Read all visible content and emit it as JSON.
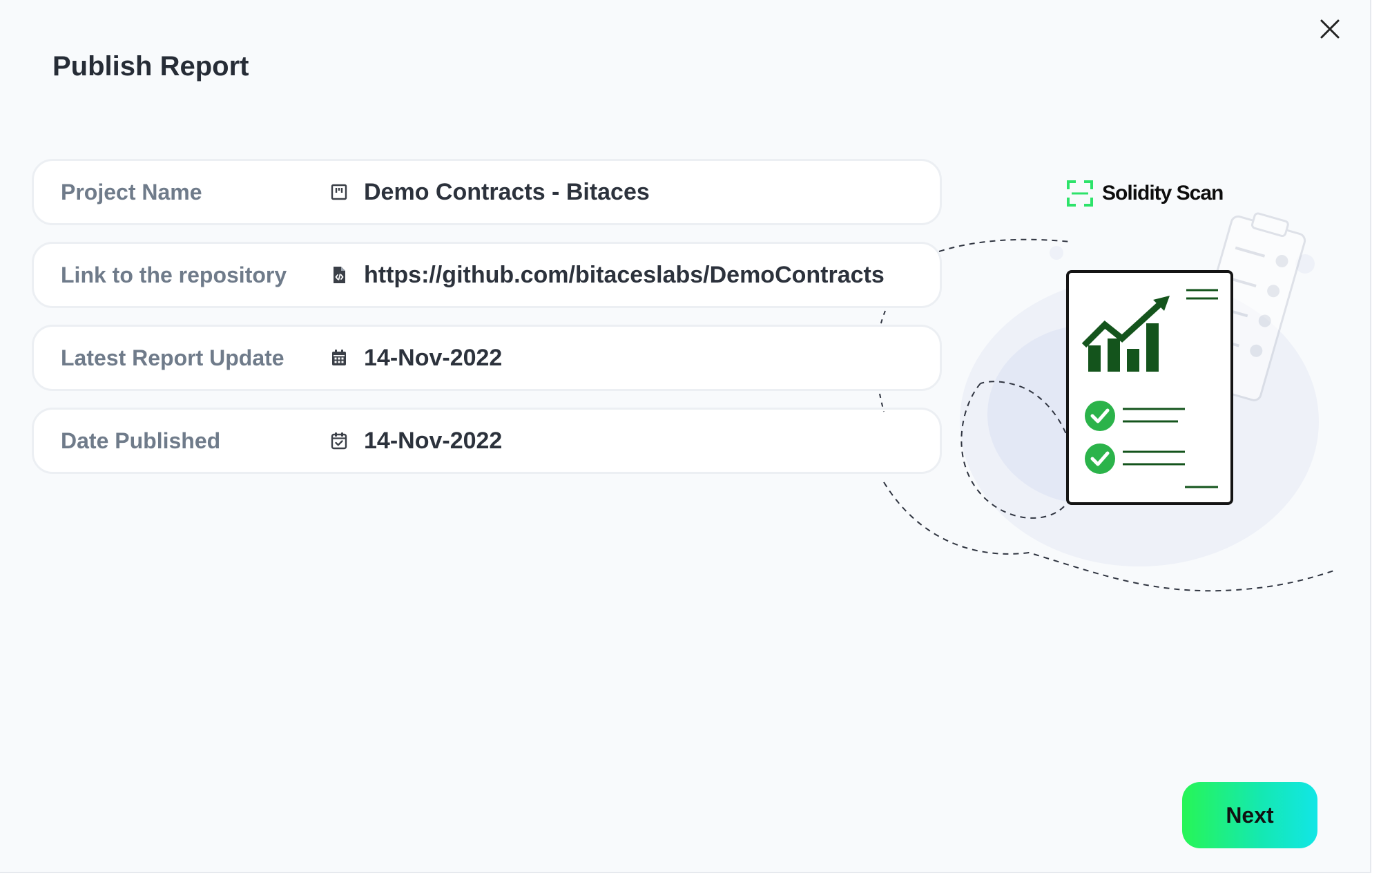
{
  "modal": {
    "title": "Publish Report",
    "close_icon": "close-icon"
  },
  "fields": [
    {
      "label": "Project Name",
      "value": "Demo Contracts - Bitaces",
      "icon": "project-icon"
    },
    {
      "label": "Link to the repository",
      "value": "https://github.com/bitaceslabs/DemoContracts",
      "icon": "code-file-icon"
    },
    {
      "label": "Latest Report Update",
      "value": "14-Nov-2022",
      "icon": "calendar-icon"
    },
    {
      "label": "Date Published",
      "value": "14-Nov-2022",
      "icon": "calendar-check-icon"
    }
  ],
  "brand": {
    "name": "Solidity Scan",
    "icon": "scan-frame-icon"
  },
  "actions": {
    "next_label": "Next"
  },
  "colors": {
    "background": "#f8fafc",
    "title_text": "#262c36",
    "label_text": "#6f7b8a",
    "value_text": "#2c323c",
    "accent_green": "#27f556",
    "accent_cyan": "#12e6e6",
    "chart_green": "#14541c",
    "check_green": "#2bb34a"
  }
}
